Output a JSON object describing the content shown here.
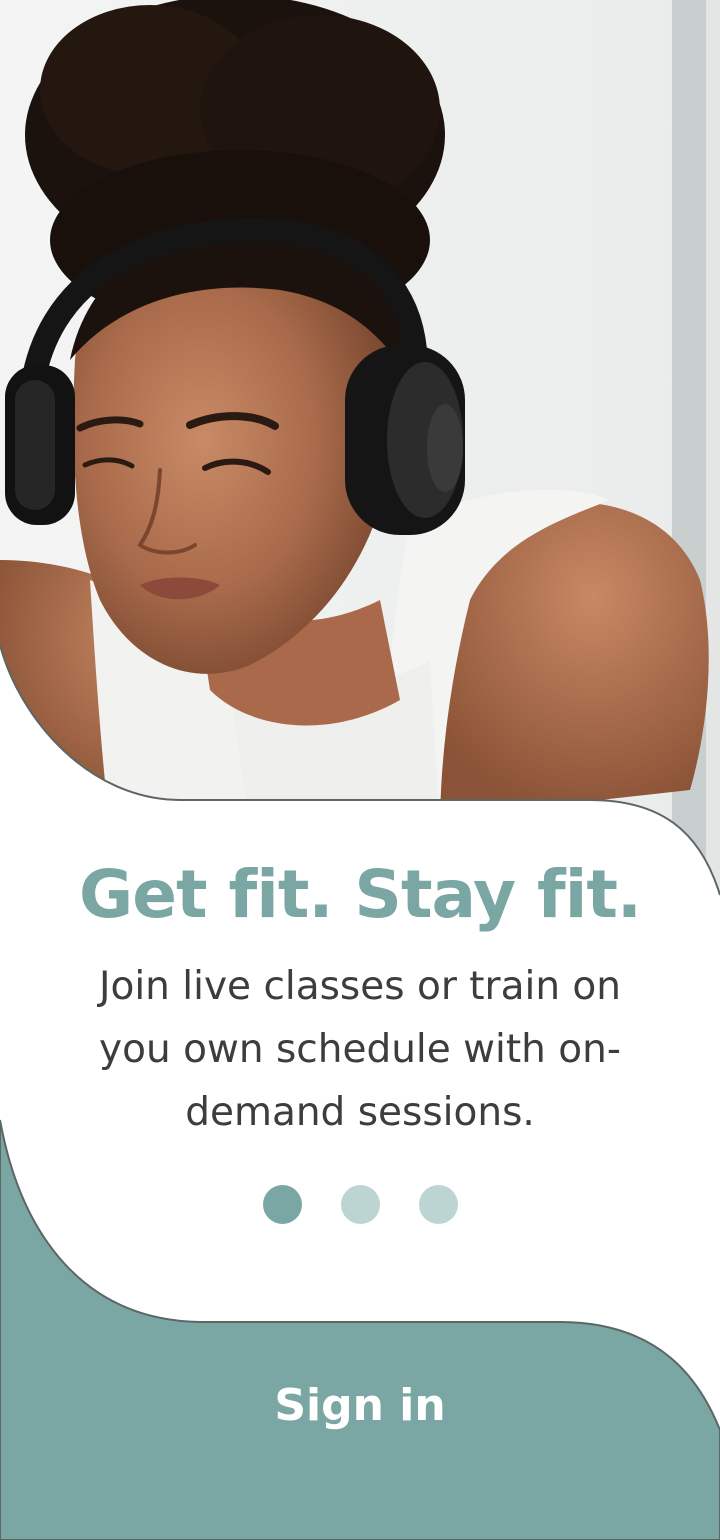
{
  "hero": {
    "image_alt": "Woman with curly hair wearing black headphones and a white tank top"
  },
  "onboarding": {
    "headline": "Get fit. Stay fit.",
    "subtitle": "Join live classes or train on you own schedule with on-demand sessions.",
    "page_indicator": {
      "current": 1,
      "total": 3
    }
  },
  "actions": {
    "sign_in_label": "Sign in"
  },
  "colors": {
    "accent": "#7aa6a3",
    "accent_light": "#bcd4d2",
    "text": "#3d3d3d",
    "background": "#ffffff"
  }
}
